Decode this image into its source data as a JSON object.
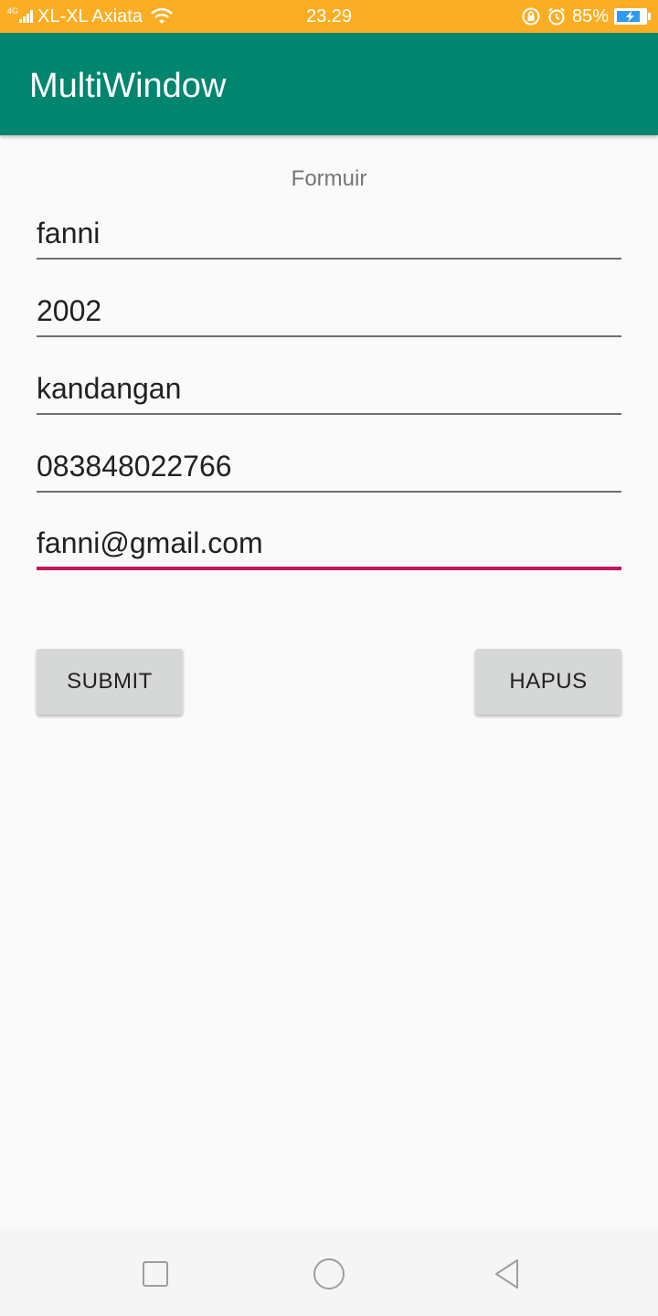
{
  "status_bar": {
    "network_type": "4G",
    "carrier": "XL-XL Axiata",
    "time": "23.29",
    "battery_percent": "85%",
    "battery_level": 0.85,
    "icons": [
      "signal-icon",
      "wifi-icon",
      "rotation-lock-icon",
      "alarm-icon",
      "battery-charging-icon"
    ],
    "color": "#fbae24"
  },
  "app_bar": {
    "title": "MultiWindow",
    "color": "#00856f"
  },
  "form": {
    "heading": "Formuir",
    "fields": [
      {
        "name": "name",
        "value": "fanni"
      },
      {
        "name": "year",
        "value": "2002"
      },
      {
        "name": "address",
        "value": "kandangan"
      },
      {
        "name": "phone",
        "value": "083848022766"
      },
      {
        "name": "email",
        "value": "fanni@gmail.com",
        "focused": true
      }
    ],
    "focus_color": "#c2185b",
    "submit_label": "SUBMIT",
    "clear_label": "HAPUS"
  },
  "nav_bar": {
    "icons": [
      "recents-icon",
      "home-icon",
      "back-icon"
    ]
  }
}
